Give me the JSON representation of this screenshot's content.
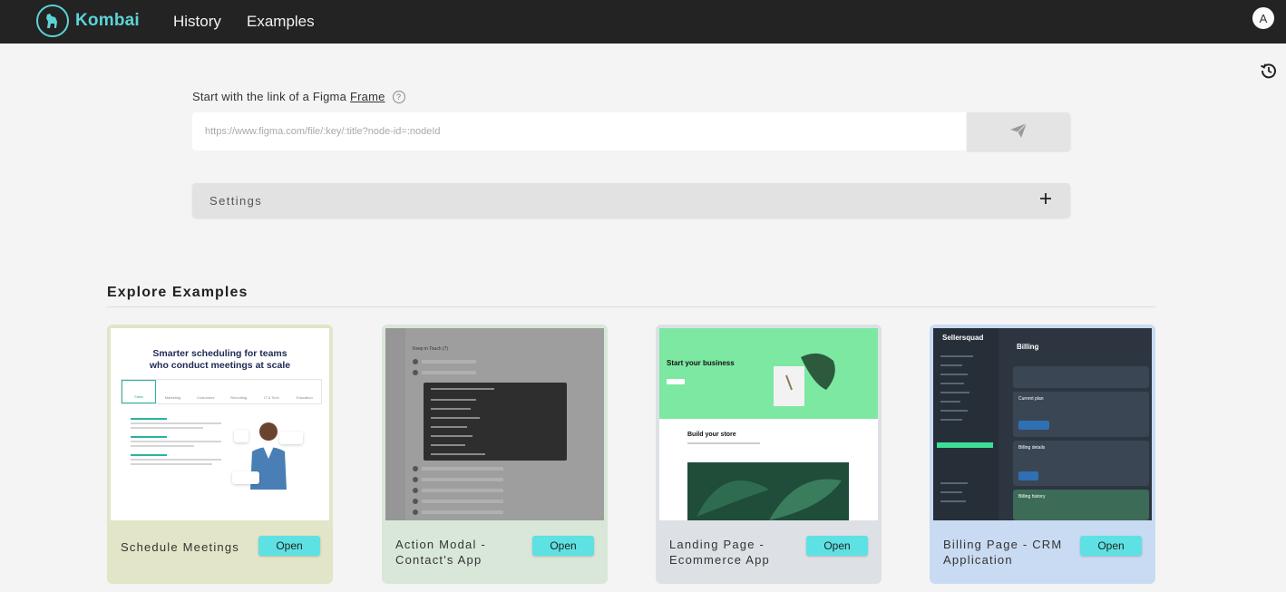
{
  "header": {
    "brand": "Kombai",
    "nav": [
      {
        "label": "History"
      },
      {
        "label": "Examples"
      }
    ],
    "avatar_initial": "A"
  },
  "figma_link": {
    "label_prefix": "Start with the link of a Figma",
    "label_link": "Frame",
    "help_glyph": "?",
    "input_value": "",
    "input_placeholder": "https://www.figma.com/file/:key/:title?node-id=:nodeId"
  },
  "settings": {
    "label": "Settings",
    "expand_glyph": "+"
  },
  "examples": {
    "title": "Explore Examples",
    "open_label": "Open",
    "cards": [
      {
        "title_line1": "Schedule Meetings",
        "title_line2": "",
        "thumb_heading_line1": "Smarter scheduling for teams",
        "thumb_heading_line2": "who conduct meetings at scale",
        "thumb_tabs": [
          "Sales",
          "Marketing",
          "Customers",
          "Recruiting",
          "IT & Tech",
          "Education"
        ]
      },
      {
        "title_line1": "Action Modal -",
        "title_line2": "Contact's App",
        "thumb_heading": "Keep in Touch (7)"
      },
      {
        "title_line1": "Landing Page -",
        "title_line2": "Ecommerce App",
        "thumb_hero": "Start your business",
        "thumb_section": "Build your store"
      },
      {
        "title_line1": "Billing Page - CRM",
        "title_line2": "Application",
        "thumb_brand": "Sellersquad",
        "thumb_title": "Billing",
        "thumb_panels": [
          "Current plan",
          "Billing details",
          "Billing history"
        ]
      }
    ]
  },
  "colors": {
    "accent": "#5ed3d6",
    "open_button": "#5ee1e3",
    "topbar": "#232323"
  }
}
